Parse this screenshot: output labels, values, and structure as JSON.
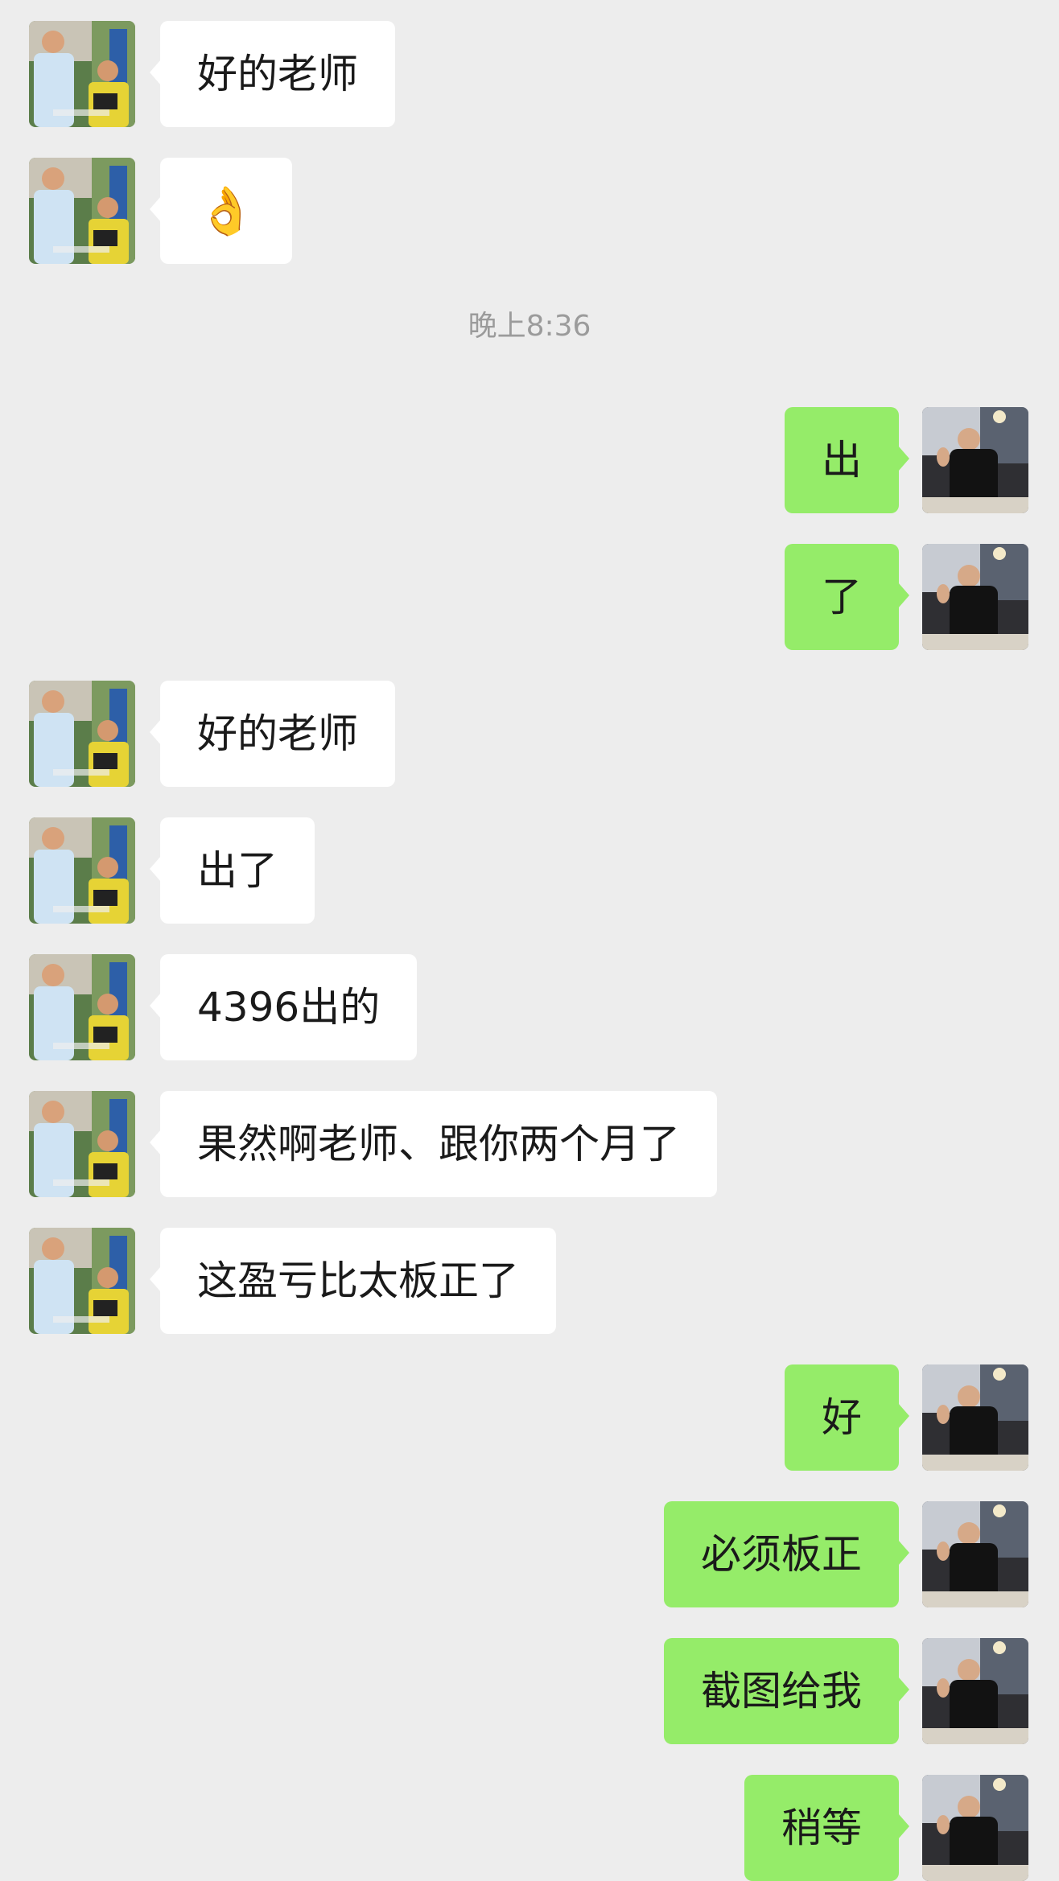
{
  "timestamp": "晚上8:36",
  "messages": [
    {
      "side": "left",
      "text": "好的老师"
    },
    {
      "side": "left",
      "text": "👌"
    },
    {
      "side": "right",
      "text": "出"
    },
    {
      "side": "right",
      "text": "了"
    },
    {
      "side": "left",
      "text": "好的老师"
    },
    {
      "side": "left",
      "text": "出了"
    },
    {
      "side": "left",
      "text": "4396出的"
    },
    {
      "side": "left",
      "text": "果然啊老师、跟你两个月了"
    },
    {
      "side": "left",
      "text": "这盈亏比太板正了"
    },
    {
      "side": "right",
      "text": "好"
    },
    {
      "side": "right",
      "text": "必须板正"
    },
    {
      "side": "right",
      "text": "截图给我"
    },
    {
      "side": "right",
      "text": "稍等"
    }
  ],
  "colors": {
    "background": "#ededed",
    "incoming_bubble": "#ffffff",
    "outgoing_bubble": "#95ec69",
    "timestamp_text": "#9b9b9b"
  },
  "avatars": {
    "left": "two-boys-photo-avatar",
    "right": "man-in-black-photo-avatar"
  }
}
